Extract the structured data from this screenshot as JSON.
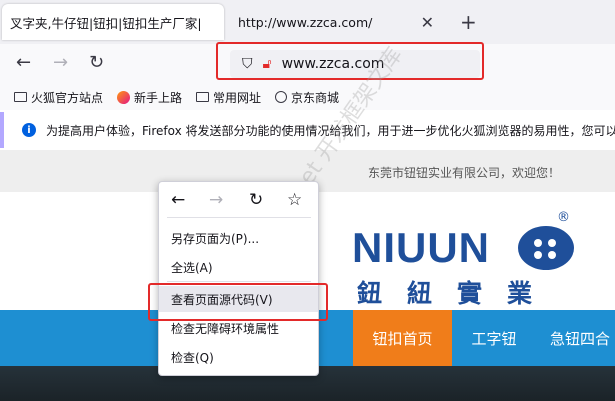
{
  "browser": {
    "tabs": [
      {
        "title": "叉字夹,牛仔钮|钮扣|钮扣生产厂家|",
        "active": true
      },
      {
        "title": "http://www.zzca.com/",
        "active": false
      }
    ],
    "url": "www.zzca.com",
    "bookmarks": [
      {
        "label": "火狐官方站点",
        "icon": "folder-icon"
      },
      {
        "label": "新手上路",
        "icon": "firefox-icon"
      },
      {
        "label": "常用网址",
        "icon": "folder-icon"
      },
      {
        "label": "京东商城",
        "icon": "globe-icon"
      }
    ],
    "notification": "为提高用户体验，Firefox 将发送部分功能的使用情况给我们，用于进一步优化火狐浏览器的易用性，您可以"
  },
  "website": {
    "welcome": "东莞市钮钮实业有限公司，欢迎您！",
    "logo_text": "NIUUN",
    "logo_reg": "®",
    "logo_cn": "鈕紐實業",
    "nav": [
      {
        "label": "钮扣首页",
        "active": true
      },
      {
        "label": "工字钮",
        "active": false
      },
      {
        "label": "急钮四合",
        "active": false
      }
    ],
    "watermark": "www.cscode.net 开发框架文库"
  },
  "context_menu": {
    "items": [
      {
        "label": "另存页面为(P)...",
        "hover": false
      },
      {
        "label": "全选(A)",
        "hover": false
      },
      {
        "label": "查看页面源代码(V)",
        "hover": true
      },
      {
        "label": "检查无障碍环境属性",
        "hover": false
      },
      {
        "label": "检查(Q)",
        "hover": false
      }
    ]
  },
  "colors": {
    "highlight_box": "#e32a2a",
    "nav_bar": "#1e8fd2",
    "nav_active": "#f07d1a",
    "logo": "#1f4f9a"
  }
}
